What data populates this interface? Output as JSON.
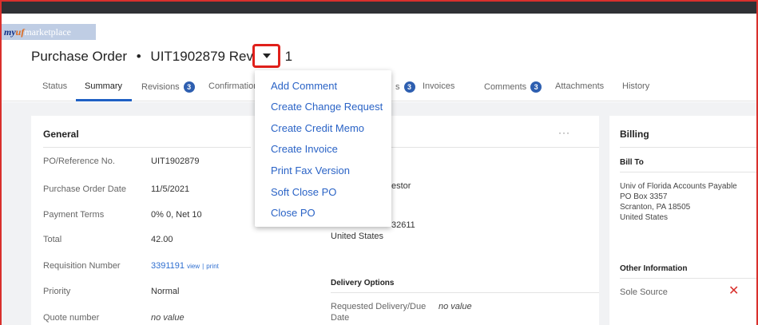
{
  "brand": {
    "my": "my",
    "uf": "uf",
    "marketplace": "marketplace"
  },
  "header": {
    "type": "Purchase Order",
    "bullet": "•",
    "number": "UIT1902879 Revision 1"
  },
  "tabs": [
    {
      "label": "Status"
    },
    {
      "label": "Summary"
    },
    {
      "label": "Revisions",
      "badge": "3"
    },
    {
      "label": "Confirmations"
    },
    {
      "label": "s",
      "badge": "3"
    },
    {
      "label": "Invoices"
    },
    {
      "label": "Comments",
      "badge": "3"
    },
    {
      "label": "Attachments"
    },
    {
      "label": "History"
    }
  ],
  "menu": {
    "items": [
      "Add Comment",
      "Create Change Request",
      "Create Credit Memo",
      "Create Invoice",
      "Print Fax Version",
      "Soft Close PO",
      "Close PO"
    ]
  },
  "general": {
    "title": "General",
    "fields": [
      {
        "label": "PO/Reference No.",
        "value": "UIT1902879"
      },
      {
        "label": "Purchase Order Date",
        "value": "11/5/2021"
      },
      {
        "label": "Payment Terms",
        "value": "0% 0, Net 10"
      },
      {
        "label": "Total",
        "value": "42.00"
      },
      {
        "label": "Requisition Number",
        "value": "3391191",
        "view": "view",
        "sep": "|",
        "print": "print"
      },
      {
        "label": "Priority",
        "value": "Normal"
      },
      {
        "label": "Quote number",
        "value": "no value"
      }
    ]
  },
  "shipping": {
    "ellipsis": "···",
    "requestor_partial": "estor",
    "zip_partial": "32611",
    "country": "United States",
    "delivery_title": "Delivery Options",
    "requested_label_1": "Requested Delivery/Due",
    "requested_label_2": "Date",
    "requested_value": "no value"
  },
  "billing": {
    "title": "Billing",
    "bill_to_title": "Bill To",
    "address": [
      "Univ of Florida Accounts Payable",
      "PO Box 3357",
      "Scranton, PA 18505",
      "United States"
    ],
    "other_title": "Other Information",
    "sole_source_label": "Sole Source",
    "sole_source_icon": "x-icon"
  },
  "colors": {
    "accent": "#1f60c4",
    "link": "#2a63c6",
    "highlight": "#e0201b",
    "negative": "#d9302c"
  }
}
